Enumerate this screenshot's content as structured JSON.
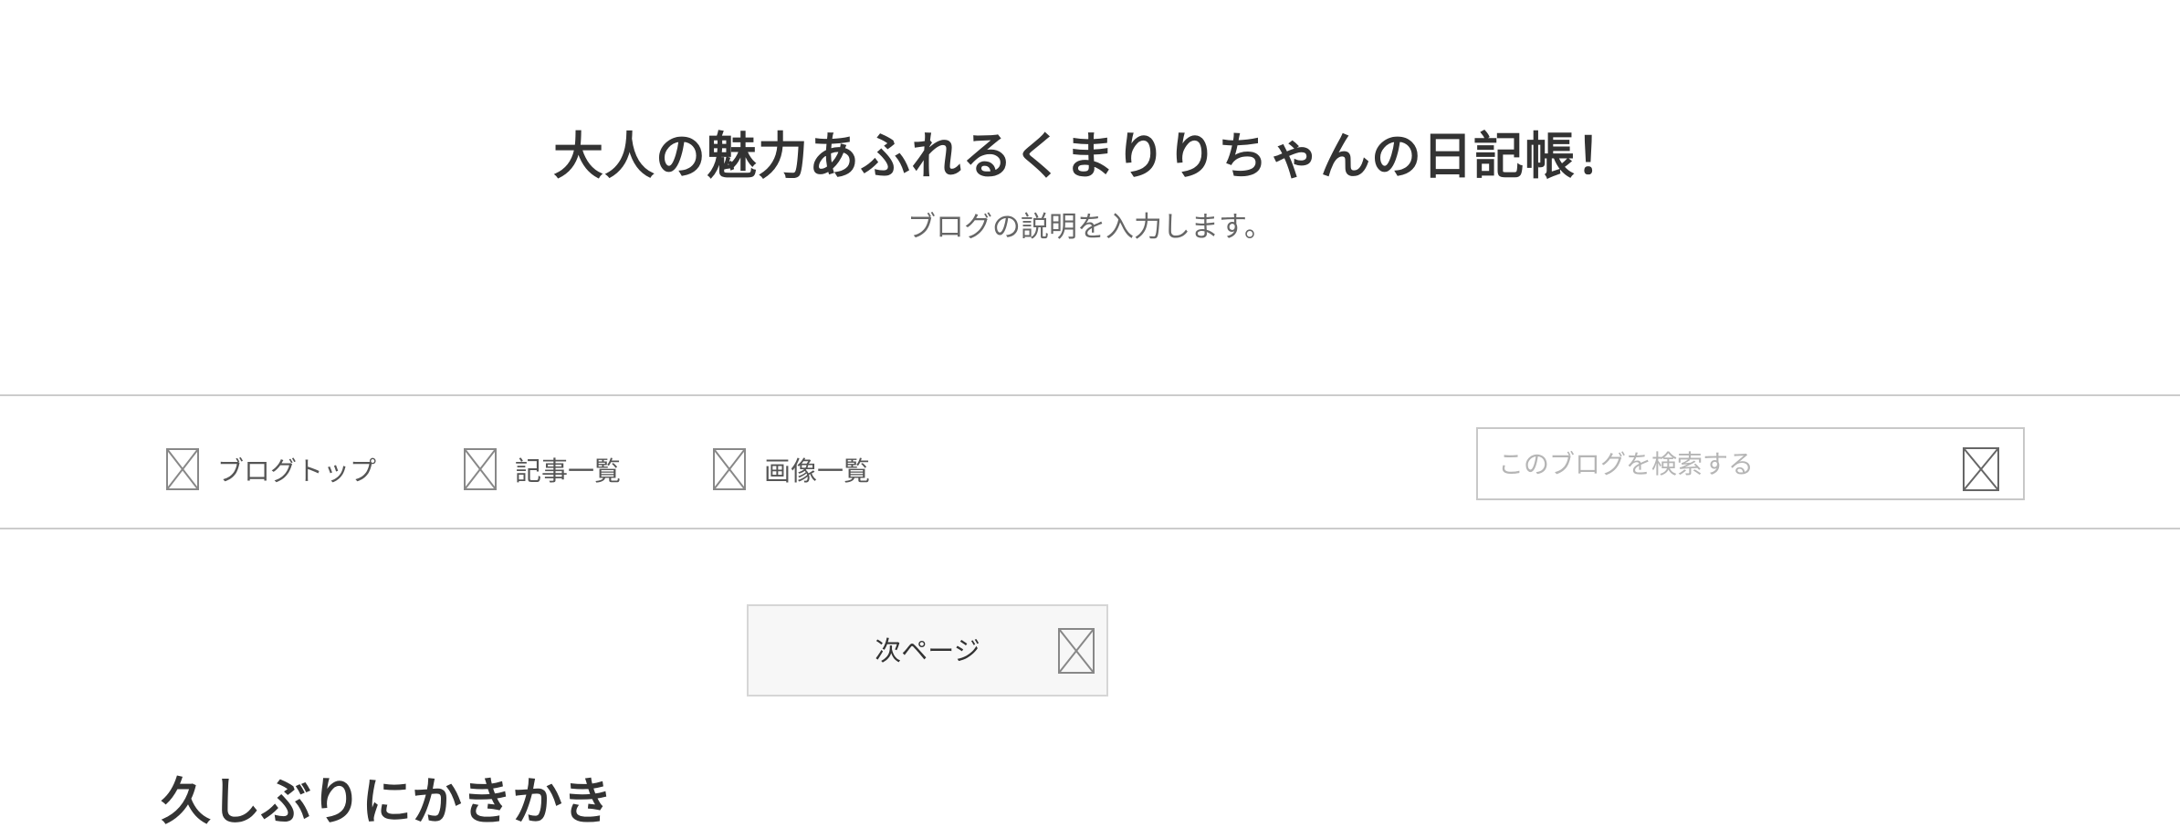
{
  "header": {
    "title": "大人の魅力あふれるくまりりちゃんの日記帳！",
    "description": "ブログの説明を入力します。"
  },
  "nav": {
    "items": [
      {
        "label": "ブログトップ",
        "icon": "broken-image-icon"
      },
      {
        "label": "記事一覧",
        "icon": "broken-image-icon"
      },
      {
        "label": "画像一覧",
        "icon": "broken-image-icon"
      }
    ],
    "search": {
      "placeholder": "このブログを検索する",
      "value": "",
      "button_icon": "broken-image-icon"
    }
  },
  "pager": {
    "next_label": "次ページ",
    "icon": "broken-image-icon"
  },
  "article": {
    "title": "久しぶりにかきかき"
  },
  "colors": {
    "text": "#333333",
    "muted": "#666666",
    "border": "#cccccc",
    "pager_bg": "#f7f7f7",
    "placeholder": "#b5b5b5"
  }
}
